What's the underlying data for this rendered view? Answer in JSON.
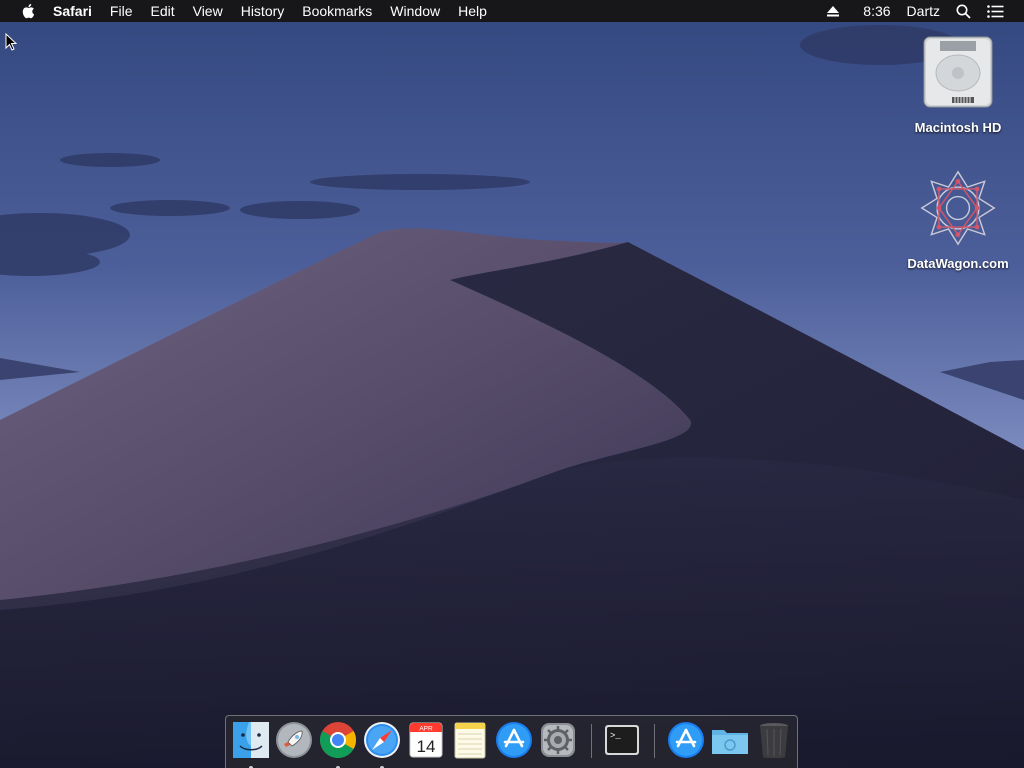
{
  "menubar": {
    "apple_icon": "apple-logo-icon",
    "app_name": "Safari",
    "menus": [
      "File",
      "Edit",
      "View",
      "History",
      "Bookmarks",
      "Window",
      "Help"
    ],
    "status": {
      "eject_icon": "eject-icon",
      "clock": "8:36",
      "user": "Dartz",
      "search_icon": "spotlight-search-icon",
      "notifications_icon": "notification-center-icon"
    }
  },
  "desktop": {
    "wallpaper": "macOS Mojave night dunes",
    "icons": [
      {
        "label": "Macintosh HD",
        "icon": "hard-drive-icon"
      },
      {
        "label": "DataWagon.com",
        "icon": "datawagon-logo-icon"
      }
    ]
  },
  "dock": {
    "apps": [
      {
        "name": "Finder",
        "icon": "finder-icon",
        "running": true
      },
      {
        "name": "Launchpad",
        "icon": "launchpad-icon",
        "running": false
      },
      {
        "name": "Google Chrome",
        "icon": "chrome-icon",
        "running": true
      },
      {
        "name": "Safari",
        "icon": "safari-icon",
        "running": true
      },
      {
        "name": "Calendar",
        "icon": "calendar-icon",
        "running": false,
        "month": "APR",
        "day": "14"
      },
      {
        "name": "Notes",
        "icon": "notes-icon",
        "running": false
      },
      {
        "name": "App Store",
        "icon": "app-store-icon",
        "running": false
      },
      {
        "name": "System Preferences",
        "icon": "system-preferences-icon",
        "running": false
      },
      {
        "name": "Terminal",
        "icon": "terminal-icon",
        "running": false,
        "prompt": ">_"
      },
      {
        "name": "Applications",
        "icon": "applications-folder-icon",
        "running": false
      },
      {
        "name": "Downloads",
        "icon": "downloads-folder-icon",
        "running": false
      },
      {
        "name": "Trash",
        "icon": "trash-icon",
        "running": false
      }
    ]
  },
  "colors": {
    "menubar_bg": "#17171a",
    "sky_top": "#3a4f8c",
    "sky_horizon": "#8a98c8",
    "dune_light": "#5e5470",
    "dune_dark": "#2a2840"
  }
}
